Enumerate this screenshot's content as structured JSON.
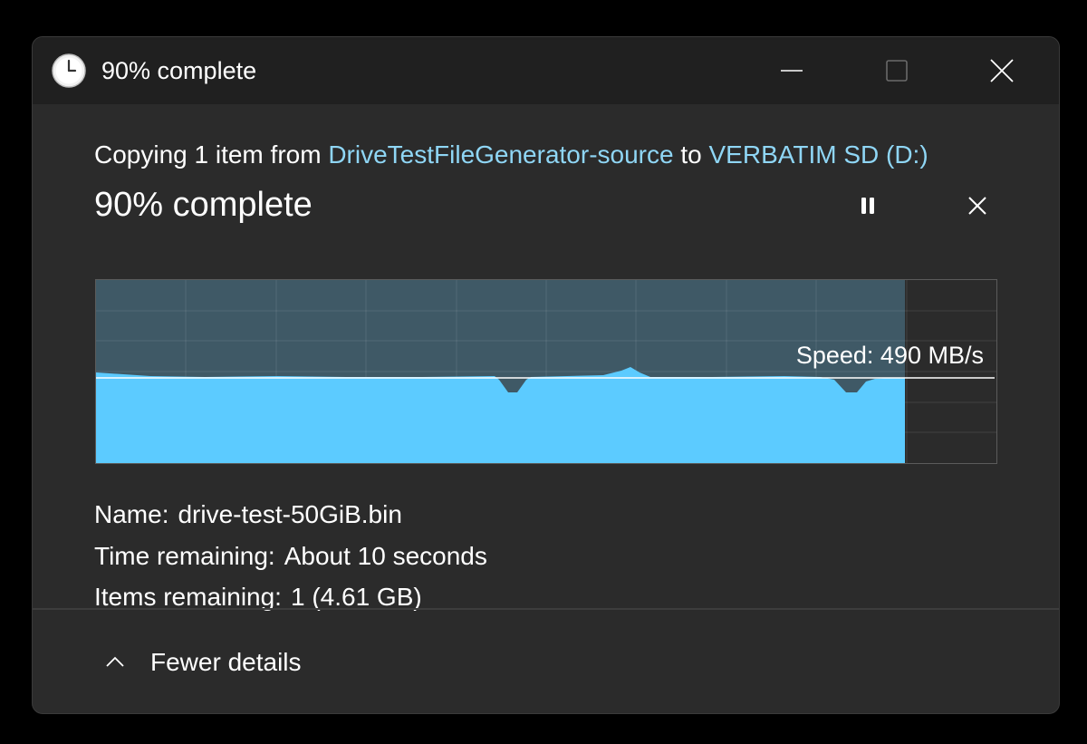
{
  "window": {
    "title": "90% complete"
  },
  "dialog": {
    "copy_prefix": "Copying 1 item from ",
    "source": "DriveTestFileGenerator-source",
    "copy_middle": " to ",
    "destination": "VERBATIM SD (D:)",
    "progress_title": "90% complete",
    "progress_fraction": 0.9
  },
  "graph": {
    "speed_label": "Speed: 490 MB/s",
    "fill_color": "#5ccbff",
    "remaining_color": "#2b2b2b",
    "background_color": "#3f5966"
  },
  "details": {
    "name_label": "Name:",
    "name_value": "drive-test-50GiB.bin",
    "time_label": "Time remaining:",
    "time_value": "About 10 seconds",
    "items_label": "Items remaining:",
    "items_value": "1 (4.61 GB)"
  },
  "footer": {
    "toggle_label": "Fewer details"
  },
  "colors": {
    "link": "#8fd6f5",
    "accent": "#5ccbff"
  }
}
